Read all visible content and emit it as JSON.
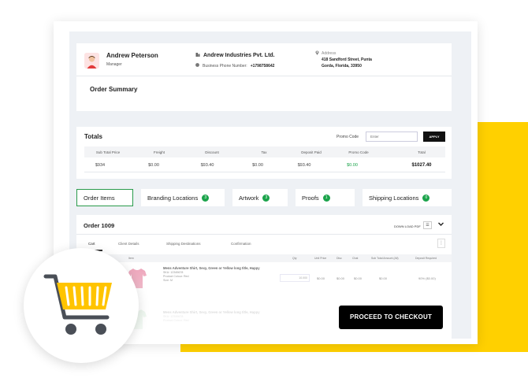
{
  "colors": {
    "accent_yellow": "#ffd000",
    "green": "#1aa34a",
    "dark": "#111111",
    "background": "#eef1f5"
  },
  "header": {
    "name": "Andrew Peterson",
    "role": "Manager",
    "company": "Andrew Industries Pvt. Ltd.",
    "phone_label": "Business Phone Number:",
    "phone": "+1798758642",
    "address_label": "Address",
    "address_line1": "418 Sandford Street, Punta",
    "address_line2": "Gorda, Florida, 33950",
    "summary_title": "Order Summary"
  },
  "totals": {
    "title": "Totals",
    "promo_label": "Promo Code",
    "promo_placeholder": "Enter",
    "apply_label": "APPLY",
    "columns": [
      "Sub Total Price",
      "Freight",
      "Discount",
      "Tax",
      "Deposit Paid",
      "Promo Code",
      "Total"
    ],
    "values": [
      "$934",
      "$0.00",
      "$93.40",
      "$0.00",
      "$93.40",
      "$0.00",
      "$1027.40"
    ]
  },
  "tabs": [
    {
      "label": "Order Items",
      "count": ""
    },
    {
      "label": "Branding  Locations",
      "count": "3"
    },
    {
      "label": "Artwork",
      "count": "3"
    },
    {
      "label": "Proofs",
      "count": "1"
    },
    {
      "label": "Shipping Locations",
      "count": "0"
    }
  ],
  "order": {
    "title": "Order   1009",
    "download_label": "DOWN LOAD PDF",
    "sub_tabs": [
      "Cart",
      "Client  Details",
      "Shipping Destinations",
      "Confirmation"
    ],
    "item_columns": [
      "Supplier",
      "Item",
      "Qty",
      "Unit Price",
      "Disc",
      "Chat",
      "Sub Total Amount (All)",
      "Deposit Required"
    ],
    "items": [
      {
        "title": "Mens Adventure Shirt, Sexy,  Green or Yellow long title, Happy",
        "sku": "SKU: 12345678",
        "colour": "Product Colour: Red",
        "size": "Size: M",
        "qty": "10.000",
        "unit_price": "$0.00",
        "disc": "$0.00",
        "chat": "$0.00",
        "subtotal": "$0.00",
        "deposit": "90% ($0.00)"
      },
      {
        "title": "Mens Adventure Shirt, Sexy,  Green or Yellow long title, Happy",
        "sku": "SKU: 12345678",
        "colour": "Product Colour: Red"
      }
    ]
  },
  "checkout_label": "PROCEED TO CHECKOUT"
}
